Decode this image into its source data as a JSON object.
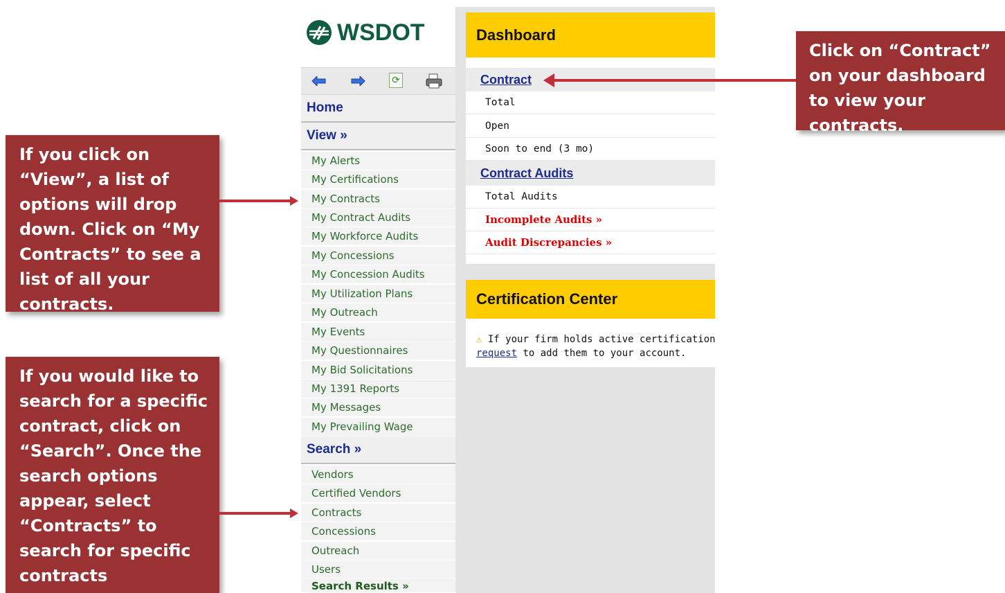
{
  "logo": {
    "text": "WSDOT"
  },
  "toolbar": {
    "back_icon": "arrow-left-icon",
    "forward_icon": "arrow-right-icon",
    "refresh_icon": "refresh-icon",
    "print_icon": "printer-icon"
  },
  "sidebar": {
    "home_label": "Home",
    "view_label": "View »",
    "view_items": [
      "My Alerts",
      "My Certifications",
      "My Contracts",
      "My Contract Audits",
      "My Workforce Audits",
      "My Concessions",
      "My Concession Audits",
      "My Utilization Plans",
      "My Outreach",
      "My Events",
      "My Questionnaires",
      "My Bid Solicitations",
      "My 1391 Reports",
      "My Messages",
      "My Prevailing Wage"
    ],
    "search_label": "Search »",
    "search_items": [
      "Vendors",
      "Certified Vendors",
      "Contracts",
      "Concessions",
      "Outreach",
      "Users"
    ],
    "search_results_label": "Search Results »"
  },
  "dashboard": {
    "title": "Dashboard",
    "contract_link": "Contract",
    "contract_rows": [
      "Total",
      "Open",
      "Soon to end (3 mo)"
    ],
    "audits_link": "Contract Audits",
    "audit_rows": [
      "Total Audits"
    ],
    "alert_rows": [
      "Incomplete Audits »",
      "Audit Discrepancies »"
    ]
  },
  "certification": {
    "title": "Certification Center",
    "line1": "If your firm holds active certifications (SBE",
    "link": "request",
    "line2_rest": " to add them to your account."
  },
  "callouts": {
    "contract": "Click on “Contract” on your dashboard to view your contracts.",
    "view": "If you click on “View”, a list of options will drop down.  Click on “My Contracts” to see a list of all your contracts.",
    "search": "If you would like to search for a specific contract, click on “Search”.  Once the search options appear, select “Contracts” to search for specific contracts"
  },
  "colors": {
    "brand_green": "#0f5c40",
    "dashboard_yellow": "#ffcc00",
    "callout_red": "#9a3133",
    "alert_red": "#e00000",
    "link_blue": "#1c2c8c"
  }
}
